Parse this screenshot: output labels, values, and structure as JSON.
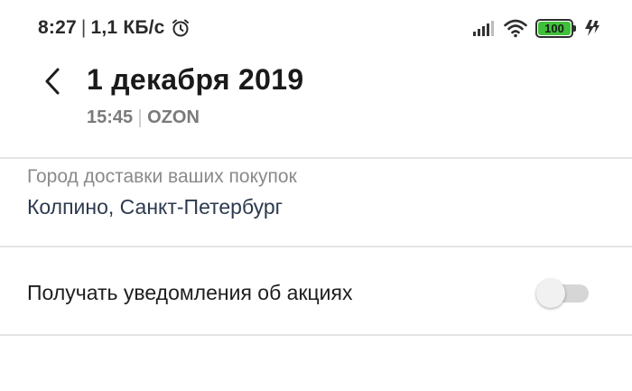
{
  "status_bar": {
    "time": "8:27",
    "separator": "|",
    "network_speed": "1,1 КБ/с",
    "battery_level": "100",
    "battery_color": "#3fbf3a",
    "icons": [
      "alarm-icon",
      "signal-icon",
      "wifi-icon",
      "battery-icon",
      "charging-icon"
    ]
  },
  "header": {
    "back_icon": "chevron-left-icon",
    "title": "1 декабря 2019",
    "time": "15:45",
    "source": "OZON"
  },
  "delivery": {
    "label": "Город доставки ваших покупок",
    "value": "Колпино, Санкт-Петербург",
    "value_color": "#2d3a4f"
  },
  "notifications": {
    "label": "Получать уведомления об акциях",
    "enabled": false
  }
}
